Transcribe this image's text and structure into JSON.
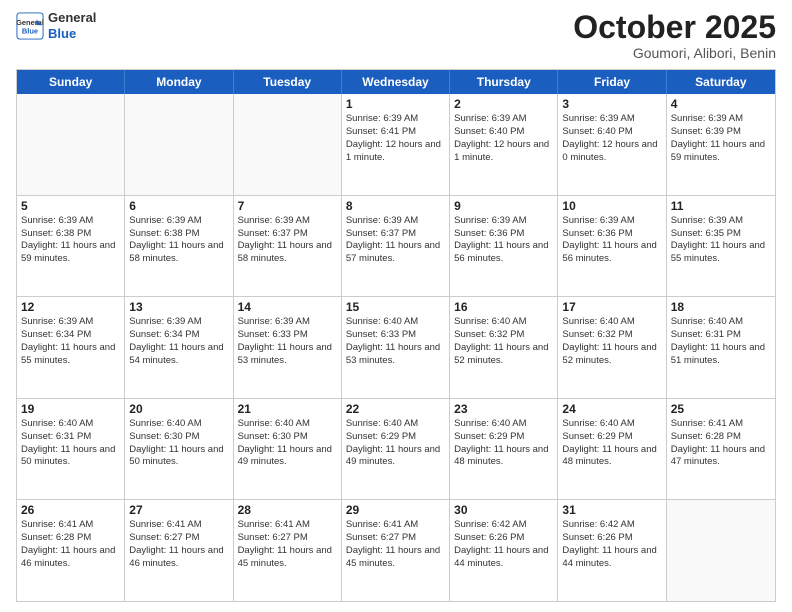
{
  "header": {
    "logo_general": "General",
    "logo_blue": "Blue",
    "month_title": "October 2025",
    "location": "Goumori, Alibori, Benin"
  },
  "days_of_week": [
    "Sunday",
    "Monday",
    "Tuesday",
    "Wednesday",
    "Thursday",
    "Friday",
    "Saturday"
  ],
  "rows": [
    [
      {
        "day": "",
        "empty": true
      },
      {
        "day": "",
        "empty": true
      },
      {
        "day": "",
        "empty": true
      },
      {
        "day": "1",
        "sunrise": "6:39 AM",
        "sunset": "6:41 PM",
        "daylight": "12 hours and 1 minute."
      },
      {
        "day": "2",
        "sunrise": "6:39 AM",
        "sunset": "6:40 PM",
        "daylight": "12 hours and 1 minute."
      },
      {
        "day": "3",
        "sunrise": "6:39 AM",
        "sunset": "6:40 PM",
        "daylight": "12 hours and 0 minutes."
      },
      {
        "day": "4",
        "sunrise": "6:39 AM",
        "sunset": "6:39 PM",
        "daylight": "11 hours and 59 minutes."
      }
    ],
    [
      {
        "day": "5",
        "sunrise": "6:39 AM",
        "sunset": "6:38 PM",
        "daylight": "11 hours and 59 minutes."
      },
      {
        "day": "6",
        "sunrise": "6:39 AM",
        "sunset": "6:38 PM",
        "daylight": "11 hours and 58 minutes."
      },
      {
        "day": "7",
        "sunrise": "6:39 AM",
        "sunset": "6:37 PM",
        "daylight": "11 hours and 58 minutes."
      },
      {
        "day": "8",
        "sunrise": "6:39 AM",
        "sunset": "6:37 PM",
        "daylight": "11 hours and 57 minutes."
      },
      {
        "day": "9",
        "sunrise": "6:39 AM",
        "sunset": "6:36 PM",
        "daylight": "11 hours and 56 minutes."
      },
      {
        "day": "10",
        "sunrise": "6:39 AM",
        "sunset": "6:36 PM",
        "daylight": "11 hours and 56 minutes."
      },
      {
        "day": "11",
        "sunrise": "6:39 AM",
        "sunset": "6:35 PM",
        "daylight": "11 hours and 55 minutes."
      }
    ],
    [
      {
        "day": "12",
        "sunrise": "6:39 AM",
        "sunset": "6:34 PM",
        "daylight": "11 hours and 55 minutes."
      },
      {
        "day": "13",
        "sunrise": "6:39 AM",
        "sunset": "6:34 PM",
        "daylight": "11 hours and 54 minutes."
      },
      {
        "day": "14",
        "sunrise": "6:39 AM",
        "sunset": "6:33 PM",
        "daylight": "11 hours and 53 minutes."
      },
      {
        "day": "15",
        "sunrise": "6:40 AM",
        "sunset": "6:33 PM",
        "daylight": "11 hours and 53 minutes."
      },
      {
        "day": "16",
        "sunrise": "6:40 AM",
        "sunset": "6:32 PM",
        "daylight": "11 hours and 52 minutes."
      },
      {
        "day": "17",
        "sunrise": "6:40 AM",
        "sunset": "6:32 PM",
        "daylight": "11 hours and 52 minutes."
      },
      {
        "day": "18",
        "sunrise": "6:40 AM",
        "sunset": "6:31 PM",
        "daylight": "11 hours and 51 minutes."
      }
    ],
    [
      {
        "day": "19",
        "sunrise": "6:40 AM",
        "sunset": "6:31 PM",
        "daylight": "11 hours and 50 minutes."
      },
      {
        "day": "20",
        "sunrise": "6:40 AM",
        "sunset": "6:30 PM",
        "daylight": "11 hours and 50 minutes."
      },
      {
        "day": "21",
        "sunrise": "6:40 AM",
        "sunset": "6:30 PM",
        "daylight": "11 hours and 49 minutes."
      },
      {
        "day": "22",
        "sunrise": "6:40 AM",
        "sunset": "6:29 PM",
        "daylight": "11 hours and 49 minutes."
      },
      {
        "day": "23",
        "sunrise": "6:40 AM",
        "sunset": "6:29 PM",
        "daylight": "11 hours and 48 minutes."
      },
      {
        "day": "24",
        "sunrise": "6:40 AM",
        "sunset": "6:29 PM",
        "daylight": "11 hours and 48 minutes."
      },
      {
        "day": "25",
        "sunrise": "6:41 AM",
        "sunset": "6:28 PM",
        "daylight": "11 hours and 47 minutes."
      }
    ],
    [
      {
        "day": "26",
        "sunrise": "6:41 AM",
        "sunset": "6:28 PM",
        "daylight": "11 hours and 46 minutes."
      },
      {
        "day": "27",
        "sunrise": "6:41 AM",
        "sunset": "6:27 PM",
        "daylight": "11 hours and 46 minutes."
      },
      {
        "day": "28",
        "sunrise": "6:41 AM",
        "sunset": "6:27 PM",
        "daylight": "11 hours and 45 minutes."
      },
      {
        "day": "29",
        "sunrise": "6:41 AM",
        "sunset": "6:27 PM",
        "daylight": "11 hours and 45 minutes."
      },
      {
        "day": "30",
        "sunrise": "6:42 AM",
        "sunset": "6:26 PM",
        "daylight": "11 hours and 44 minutes."
      },
      {
        "day": "31",
        "sunrise": "6:42 AM",
        "sunset": "6:26 PM",
        "daylight": "11 hours and 44 minutes."
      },
      {
        "day": "",
        "empty": true
      }
    ]
  ]
}
